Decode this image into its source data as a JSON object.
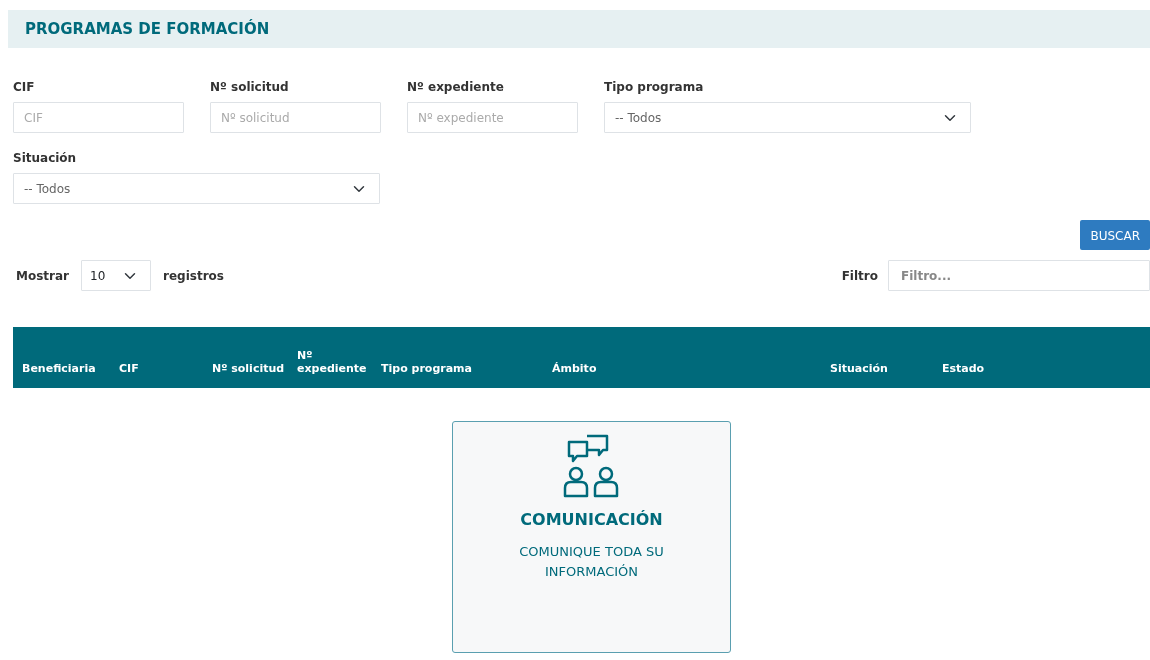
{
  "page_title": "PROGRAMAS DE FORMACIÓN",
  "filters": [
    {
      "kind": "input",
      "label": "CIF",
      "placeholder": "CIF"
    },
    {
      "kind": "input",
      "label": "Nº solicitud",
      "placeholder": "Nº solicitud"
    },
    {
      "kind": "input",
      "label": "Nº expediente",
      "placeholder": "Nº expediente"
    },
    {
      "kind": "select",
      "label": "Tipo programa",
      "value": "-- Todos"
    },
    {
      "kind": "select",
      "label": "Situación",
      "value": "-- Todos"
    }
  ],
  "search_button": "BUSCAR",
  "length": {
    "before": "Mostrar",
    "value": "10",
    "after": "registros"
  },
  "filter": {
    "label": "Filtro",
    "placeholder": "Filtro..."
  },
  "table": {
    "columns": [
      "Beneficiaria",
      "CIF",
      "Nº solicitud",
      "Nº expediente",
      "Tipo programa",
      "Ámbito",
      "Situación",
      "Estado"
    ]
  },
  "card": {
    "title": "COMUNICACIÓN",
    "text": "COMUNIQUE TODA SU INFORMACIÓN"
  }
}
